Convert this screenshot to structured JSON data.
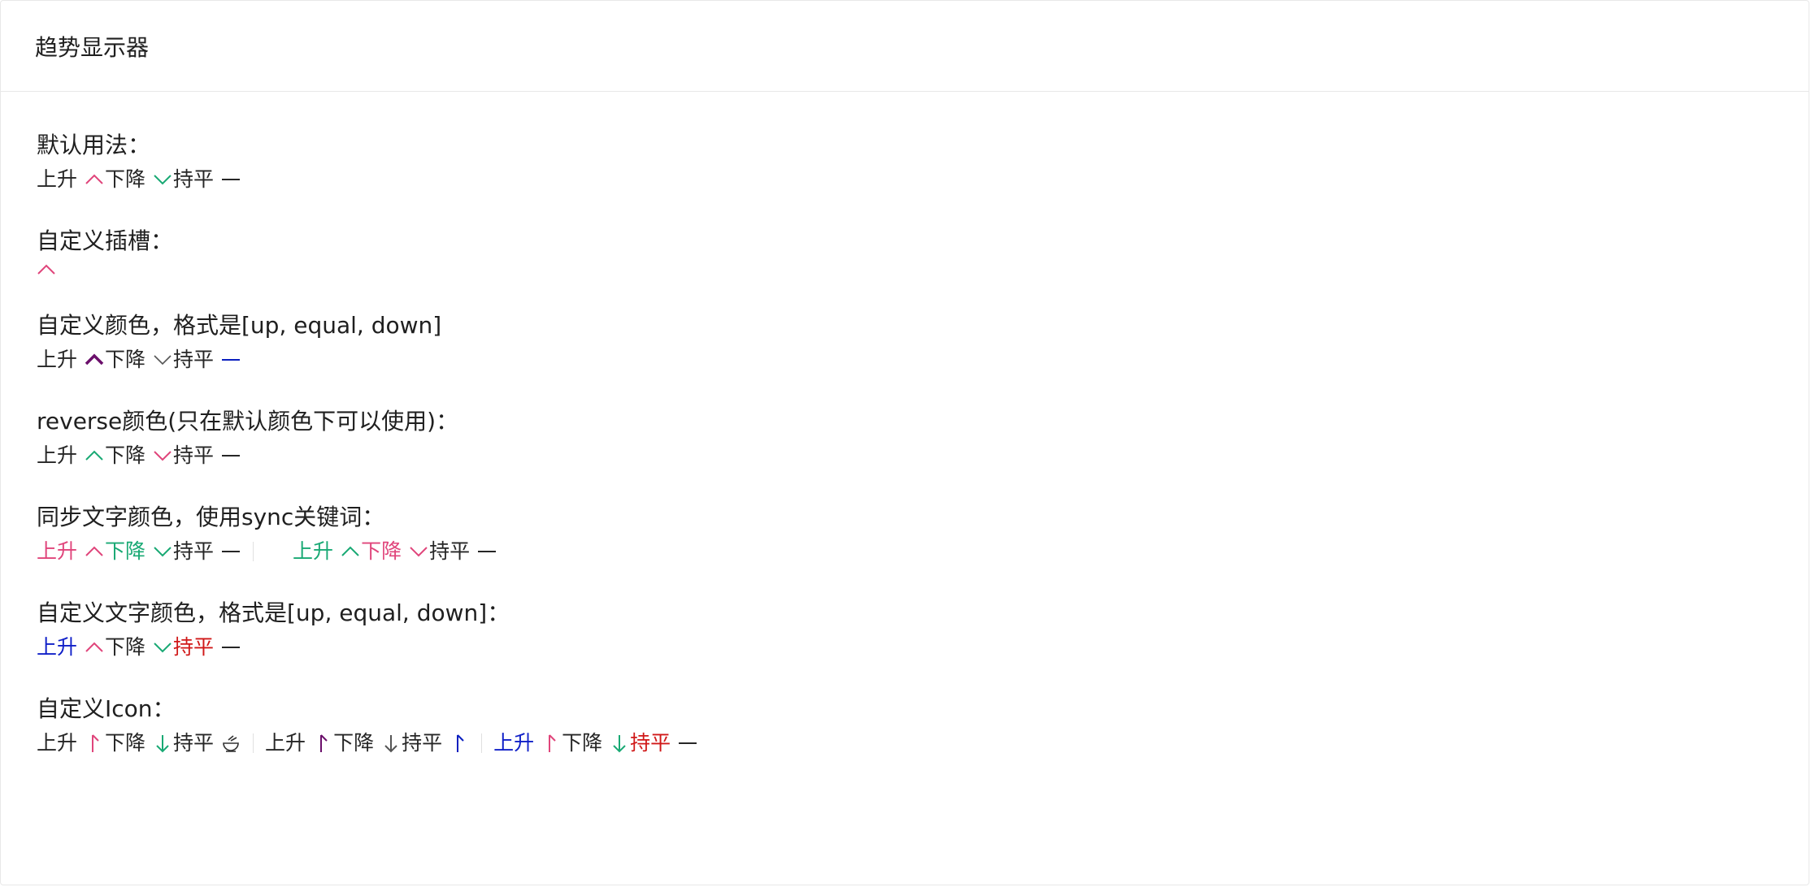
{
  "header": {
    "title": "趋势显示器"
  },
  "colors": {
    "default_up": "#e0457b",
    "default_down": "#19a974",
    "default_equal": "#262626",
    "custom_up": "#6b0f6b",
    "custom_equal": "#0a1fbf",
    "custom_down": "#555555",
    "text_blue": "#1020c8",
    "text_red": "#d01818"
  },
  "sections": {
    "default": {
      "title": "默认用法：",
      "up": "上升",
      "down": "下降",
      "equal": "持平"
    },
    "slot": {
      "title": "自定义插槽："
    },
    "custom_color": {
      "title": "自定义颜色，格式是[up, equal, down]",
      "up": "上升",
      "down": "下降",
      "equal": "持平"
    },
    "reverse": {
      "title": "reverse颜色(只在默认颜色下可以使用)：",
      "up": "上升",
      "down": "下降",
      "equal": "持平"
    },
    "sync": {
      "title": "同步文字颜色，使用sync关键词：",
      "a_up": "上升",
      "a_down": "下降",
      "a_equal": "持平",
      "b_up": "上升",
      "b_down": "下降",
      "b_equal": "持平"
    },
    "custom_text_color": {
      "title": "自定义文字颜色，格式是[up, equal, down]：",
      "up": "上升",
      "down": "下降",
      "equal": "持平"
    },
    "custom_icon": {
      "title": "自定义Icon：",
      "a_up": "上升",
      "a_down": "下降",
      "a_equal": "持平",
      "b_up": "上升",
      "b_down": "下降",
      "b_equal": "持平",
      "c_up": "上升",
      "c_down": "下降",
      "c_equal": "持平"
    }
  }
}
